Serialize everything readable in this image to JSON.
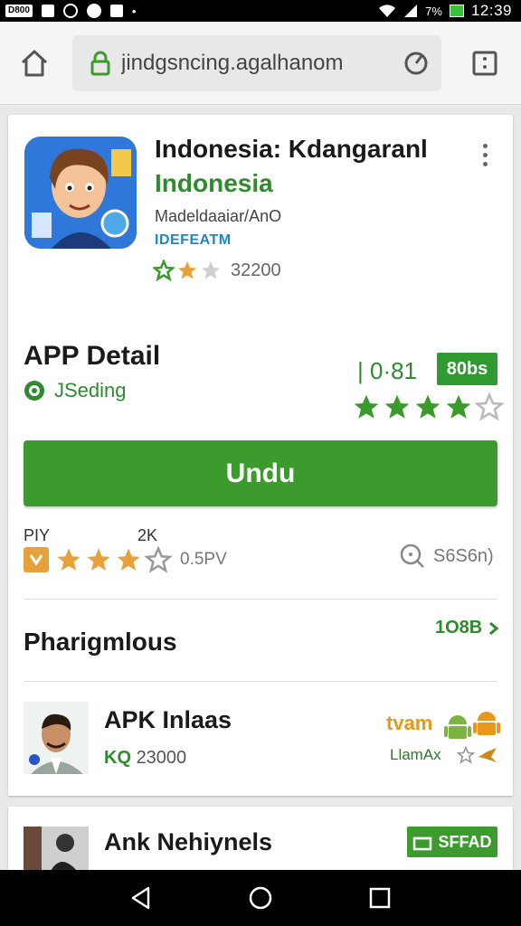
{
  "status_bar": {
    "left_badge": "D800",
    "battery_text": "7%",
    "time": "12:39"
  },
  "browser": {
    "url": "jindgsncing.agalhanom"
  },
  "app": {
    "title": "Indonesia: Kdangaranl",
    "subtitle": "Indonesia",
    "developer": "Madeldaaiar/AnO",
    "category": "IDEFEATM",
    "rating_count": "32200",
    "top_rating_stars": 2
  },
  "detail": {
    "heading": "APP Detail",
    "status": "JSeding",
    "number": "| 0·81",
    "size_badge": "80bs",
    "stars": 4
  },
  "download": {
    "label": "Undu"
  },
  "meta": {
    "label1": "PIY",
    "label2": "2K",
    "rating_text": "0.5PV",
    "search_text": "S6S6n)",
    "stars": 3
  },
  "section": {
    "heading": "Pharigmlous",
    "more": "1O8B"
  },
  "list_item": {
    "title": "APK Inlaas",
    "meta_k": "KQ",
    "meta_value": "23000",
    "right_top": "tvam",
    "right_bottom": "LlamAx"
  },
  "card2": {
    "title": "Ank Nehiynels",
    "badge": "SFFAD"
  },
  "colors": {
    "accent_green": "#3b9b2c",
    "text_green": "#2e8b2e",
    "star_green": "#3a9a2a",
    "star_gold": "#e8a13a"
  }
}
